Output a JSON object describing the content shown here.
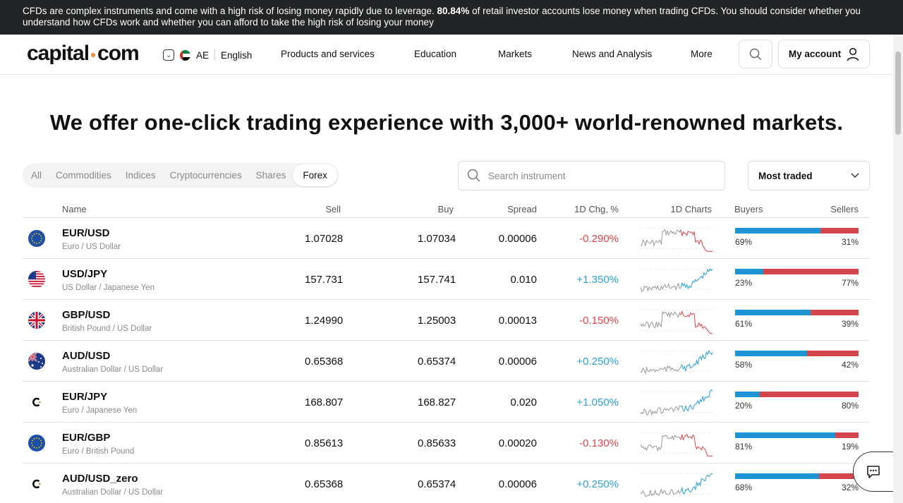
{
  "banner": {
    "text_before": "CFDs are complex instruments and come with a high risk of losing money rapidly due to leverage. ",
    "highlight": "80.84%",
    "text_after": " of retail investor accounts lose money when trading CFDs. You should consider whether you understand how CFDs work and whether you can afford to take the high risk of losing your money"
  },
  "header": {
    "logo_left": "capital",
    "logo_right": "com",
    "region": "AE",
    "language": "English",
    "nav": [
      "Products and services",
      "Education",
      "Markets",
      "News and Analysis",
      "More"
    ],
    "account_label": "My account"
  },
  "headline": "We offer one-click trading experience with 3,000+ world-renowned markets.",
  "tabs": [
    "All",
    "Commodities",
    "Indices",
    "Cryptocurrencies",
    "Shares",
    "Forex"
  ],
  "active_tab": "Forex",
  "search": {
    "placeholder": "Search instrument"
  },
  "sort": {
    "label": "Most traded"
  },
  "columns": {
    "name": "Name",
    "sell": "Sell",
    "buy": "Buy",
    "spread": "Spread",
    "change": "1D Chg, %",
    "charts": "1D Charts",
    "buyers": "Buyers",
    "sellers": "Sellers"
  },
  "colors": {
    "negative": "#e0454d",
    "positive": "#2c9fd6",
    "buyers": "#1f94d4",
    "sellers": "#d2464b",
    "accent": "#ef8a39"
  },
  "rows": [
    {
      "symbol": "EUR/USD",
      "desc": "Euro / US Dollar",
      "sell": "1.07028",
      "buy": "1.07034",
      "spread": "0.00006",
      "change": "-0.290%",
      "trend": "down",
      "buyers": 69,
      "sellers": 31,
      "buyers_label": "69%",
      "sellers_label": "31%",
      "flag": "eu-flag-icon"
    },
    {
      "symbol": "USD/JPY",
      "desc": "US Dollar / Japanese Yen",
      "sell": "157.731",
      "buy": "157.741",
      "spread": "0.010",
      "change": "+1.350%",
      "trend": "up",
      "buyers": 23,
      "sellers": 77,
      "buyers_label": "23%",
      "sellers_label": "77%",
      "flag": "us-flag-icon"
    },
    {
      "symbol": "GBP/USD",
      "desc": "British Pound / US Dollar",
      "sell": "1.24990",
      "buy": "1.25003",
      "spread": "0.00013",
      "change": "-0.150%",
      "trend": "down",
      "buyers": 61,
      "sellers": 39,
      "buyers_label": "61%",
      "sellers_label": "39%",
      "flag": "uk-flag-icon"
    },
    {
      "symbol": "AUD/USD",
      "desc": "Australian Dollar / US Dollar",
      "sell": "0.65368",
      "buy": "0.65374",
      "spread": "0.00006",
      "change": "+0.250%",
      "trend": "up",
      "buyers": 58,
      "sellers": 42,
      "buyers_label": "58%",
      "sellers_label": "42%",
      "flag": "au-flag-icon"
    },
    {
      "symbol": "EUR/JPY",
      "desc": "Euro / Japanese Yen",
      "sell": "168.807",
      "buy": "168.827",
      "spread": "0.020",
      "change": "+1.050%",
      "trend": "up",
      "buyers": 20,
      "sellers": 80,
      "buyers_label": "20%",
      "sellers_label": "80%",
      "flag": "capital-logo-icon"
    },
    {
      "symbol": "EUR/GBP",
      "desc": "Euro / British Pound",
      "sell": "0.85613",
      "buy": "0.85633",
      "spread": "0.00020",
      "change": "-0.130%",
      "trend": "down",
      "buyers": 81,
      "sellers": 19,
      "buyers_label": "81%",
      "sellers_label": "19%",
      "flag": "eu-flag-icon"
    },
    {
      "symbol": "AUD/USD_zero",
      "desc": "Australian Dollar / US Dollar",
      "sell": "0.65368",
      "buy": "0.65374",
      "spread": "0.00006",
      "change": "+0.250%",
      "trend": "up",
      "buyers": 68,
      "sellers": 32,
      "buyers_label": "68%",
      "sellers_label": "32%",
      "flag": "capital-logo-icon"
    }
  ]
}
